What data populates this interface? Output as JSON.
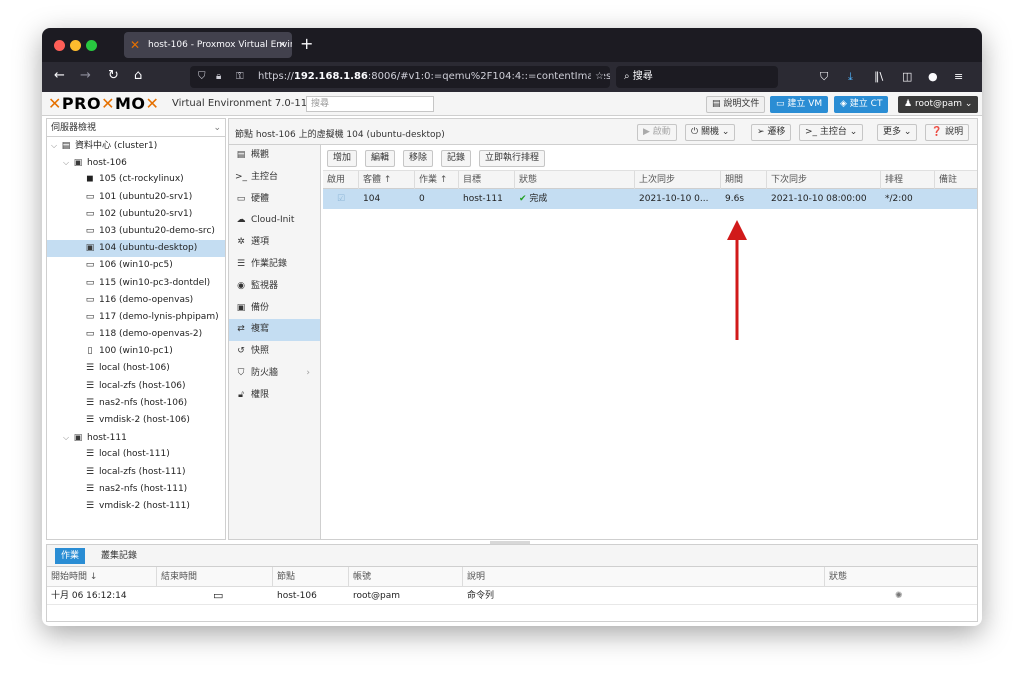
{
  "browser": {
    "tab_title": "host-106 - Proxmox Virtual Envir",
    "tab_close": "×",
    "new_tab": "+",
    "url_prefix": "https://",
    "url_host": "192.168.1.86",
    "url_rest": ":8006/#v1:0:=qemu%2F104:4::=contentImages",
    "search_label": "搜尋"
  },
  "pve": {
    "logo_left": "PRO",
    "logo_right": "MO",
    "version": "Virtual Environment 7.0-11",
    "search_placeholder": "搜尋",
    "btn_docs": "說明文件",
    "btn_create_vm": "建立 VM",
    "btn_create_ct": "建立 CT",
    "user": "root@pam"
  },
  "tree": {
    "view": "伺服器檢視",
    "items": [
      {
        "label": "資料中心 (cluster1)",
        "icon": "datacenter-icon"
      },
      {
        "label": "host-106",
        "icon": "node-icon"
      },
      {
        "label": "105 (ct-rockylinux)",
        "icon": "container-icon"
      },
      {
        "label": "101 (ubuntu20-srv1)",
        "icon": "vm-icon"
      },
      {
        "label": "102 (ubuntu20-srv1)",
        "icon": "vm-icon"
      },
      {
        "label": "103 (ubuntu20-demo-src)",
        "icon": "vm-icon"
      },
      {
        "label": "104 (ubuntu-desktop)",
        "icon": "vm-running-icon"
      },
      {
        "label": "106 (win10-pc5)",
        "icon": "vm-icon"
      },
      {
        "label": "115 (win10-pc3-dontdel)",
        "icon": "vm-icon"
      },
      {
        "label": "116 (demo-openvas)",
        "icon": "vm-icon"
      },
      {
        "label": "117 (demo-lynis-phpipam)",
        "icon": "vm-icon"
      },
      {
        "label": "118 (demo-openvas-2)",
        "icon": "vm-icon"
      },
      {
        "label": "100 (win10-pc1)",
        "icon": "template-icon"
      },
      {
        "label": "local (host-106)",
        "icon": "storage-icon"
      },
      {
        "label": "local-zfs (host-106)",
        "icon": "storage-icon"
      },
      {
        "label": "nas2-nfs (host-106)",
        "icon": "storage-icon"
      },
      {
        "label": "vmdisk-2 (host-106)",
        "icon": "storage-icon"
      },
      {
        "label": "host-111",
        "icon": "node-icon"
      },
      {
        "label": "local (host-111)",
        "icon": "storage-icon"
      },
      {
        "label": "local-zfs (host-111)",
        "icon": "storage-icon"
      },
      {
        "label": "nas2-nfs (host-111)",
        "icon": "storage-icon"
      },
      {
        "label": "vmdisk-2 (host-111)",
        "icon": "storage-icon"
      }
    ]
  },
  "main": {
    "title": "節點 host-106 上的虛擬機 104 (ubuntu-desktop)",
    "btn_start": "啟動",
    "btn_shutdown": "關機",
    "btn_migrate": "遷移",
    "btn_console": "主控台",
    "btn_more": "更多",
    "btn_help": "說明",
    "menu": [
      {
        "label": "概觀",
        "icon": "book-icon"
      },
      {
        "label": "主控台",
        "icon": "terminal-icon"
      },
      {
        "label": "硬體",
        "icon": "monitor-icon"
      },
      {
        "label": "Cloud-Init",
        "icon": "cloud-icon"
      },
      {
        "label": "選項",
        "icon": "gear-icon"
      },
      {
        "label": "作業記錄",
        "icon": "list-icon"
      },
      {
        "label": "監視器",
        "icon": "eye-icon"
      },
      {
        "label": "備份",
        "icon": "floppy-icon"
      },
      {
        "label": "複寫",
        "icon": "retweet-icon"
      },
      {
        "label": "快照",
        "icon": "history-icon"
      },
      {
        "label": "防火牆",
        "icon": "shield-icon"
      },
      {
        "label": "權限",
        "icon": "unlock-icon"
      }
    ],
    "toolbar": {
      "add": "增加",
      "edit": "編輯",
      "remove": "移除",
      "log": "記錄",
      "schedule_now": "立即執行排程"
    },
    "columns": {
      "enabled": "啟用",
      "guest": "客體 ↑",
      "job": "作業 ↑",
      "target": "目標",
      "status": "狀態",
      "last_sync": "上次同步",
      "duration": "期間",
      "next_sync": "下次同步",
      "schedule": "排程",
      "comment": "備註"
    },
    "rows": [
      {
        "guest": "104",
        "job": "0",
        "target": "host-111",
        "status": "完成",
        "last_sync": "2021-10-10 0...",
        "duration": "9.6s",
        "next_sync": "2021-10-10 08:00:00",
        "schedule": "*/2:00"
      }
    ]
  },
  "bottom": {
    "tab_tasks": "作業",
    "tab_cluster_log": "叢集記錄",
    "columns": {
      "start_time": "開始時間 ↓",
      "end_time": "結束時間",
      "node": "節點",
      "user": "帳號",
      "description": "說明",
      "status": "狀態"
    },
    "rows": [
      {
        "start_time": "十月 06 16:12:14",
        "node": "host-106",
        "user": "root@pam",
        "description": "命令列"
      }
    ]
  },
  "colors": {
    "accent": "#2a8dd4",
    "selection": "#c4ddf2",
    "proxmox_orange": "#e57000",
    "annotation_arrow": "#d11a1a"
  }
}
